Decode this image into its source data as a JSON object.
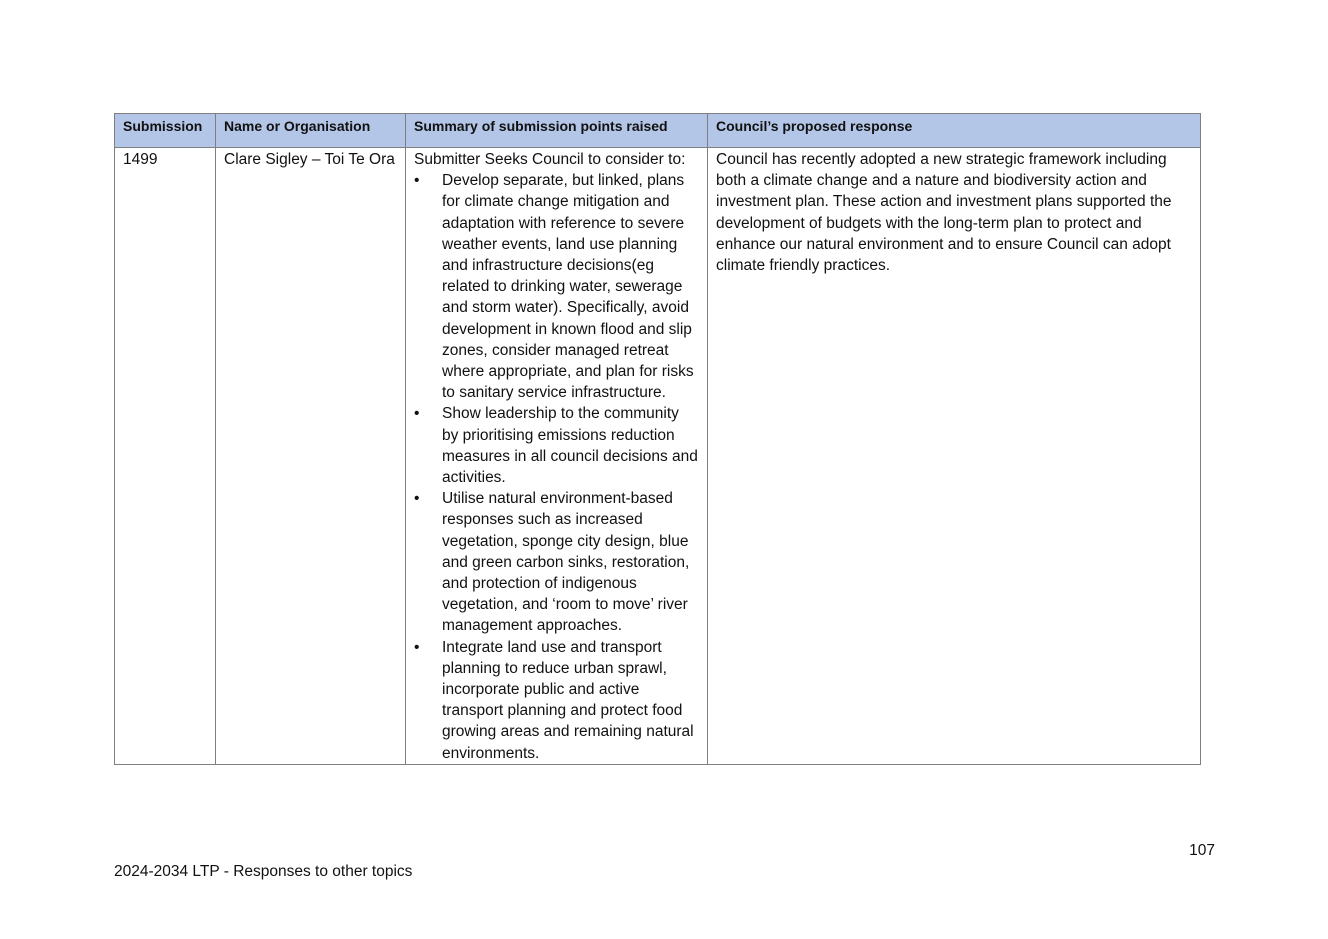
{
  "table": {
    "headers": [
      "Submission",
      "Name or Organisation",
      "Summary of submission points raised",
      "Council’s proposed response"
    ],
    "rows": [
      {
        "submission": "1499",
        "name": "Clare Sigley – Toi Te Ora",
        "summary_intro": "Submitter Seeks Council to consider to:",
        "summary_points": [
          "Develop separate, but linked, plans for climate change mitigation and adaptation with reference to severe weather events, land use planning and infrastructure decisions(eg related to drinking water, sewerage and storm water). Specifically, avoid development in known flood and slip zones, consider managed retreat where appropriate, and plan for risks to sanitary service infrastructure.",
          "Show leadership to the community by prioritising emissions reduction measures in all council decisions and activities.",
          "Utilise natural environment-based responses such as increased vegetation, sponge city design, blue and green carbon sinks, restoration, and protection of indigenous vegetation, and ‘room to move’ river management approaches.",
          "Integrate land use and transport planning to reduce urban sprawl, incorporate public and active transport planning and protect food growing areas and remaining natural environments."
        ],
        "response": "Council has recently adopted a new strategic framework including both a climate change and a nature and biodiversity action and investment plan.  These action and investment plans supported the development of budgets with the long-term plan to protect and enhance our natural environment and to ensure Council can adopt climate friendly practices."
      }
    ]
  },
  "bullet_symbol": "•",
  "page_number": "107",
  "footer_text": "2024-2034 LTP - Responses to other topics",
  "colors": {
    "header_background": "#b4c6e7",
    "border": "#7f7f7f"
  }
}
